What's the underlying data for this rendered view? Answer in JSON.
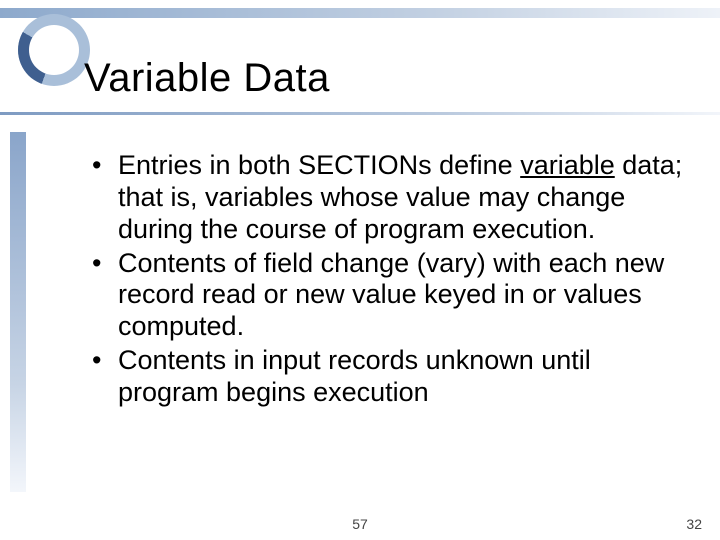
{
  "title": "Variable Data",
  "bullets": [
    {
      "pre": "Entries in both SECTIONs define ",
      "underlined": "variable",
      "post": " data;  that is, variables whose value may change during the course of program execution."
    },
    {
      "text": "Contents of field change (vary) with each new record read or new value keyed in or values computed."
    },
    {
      "text": "Contents in input records unknown until program begins execution"
    }
  ],
  "footer_center": "57",
  "footer_right": "32"
}
